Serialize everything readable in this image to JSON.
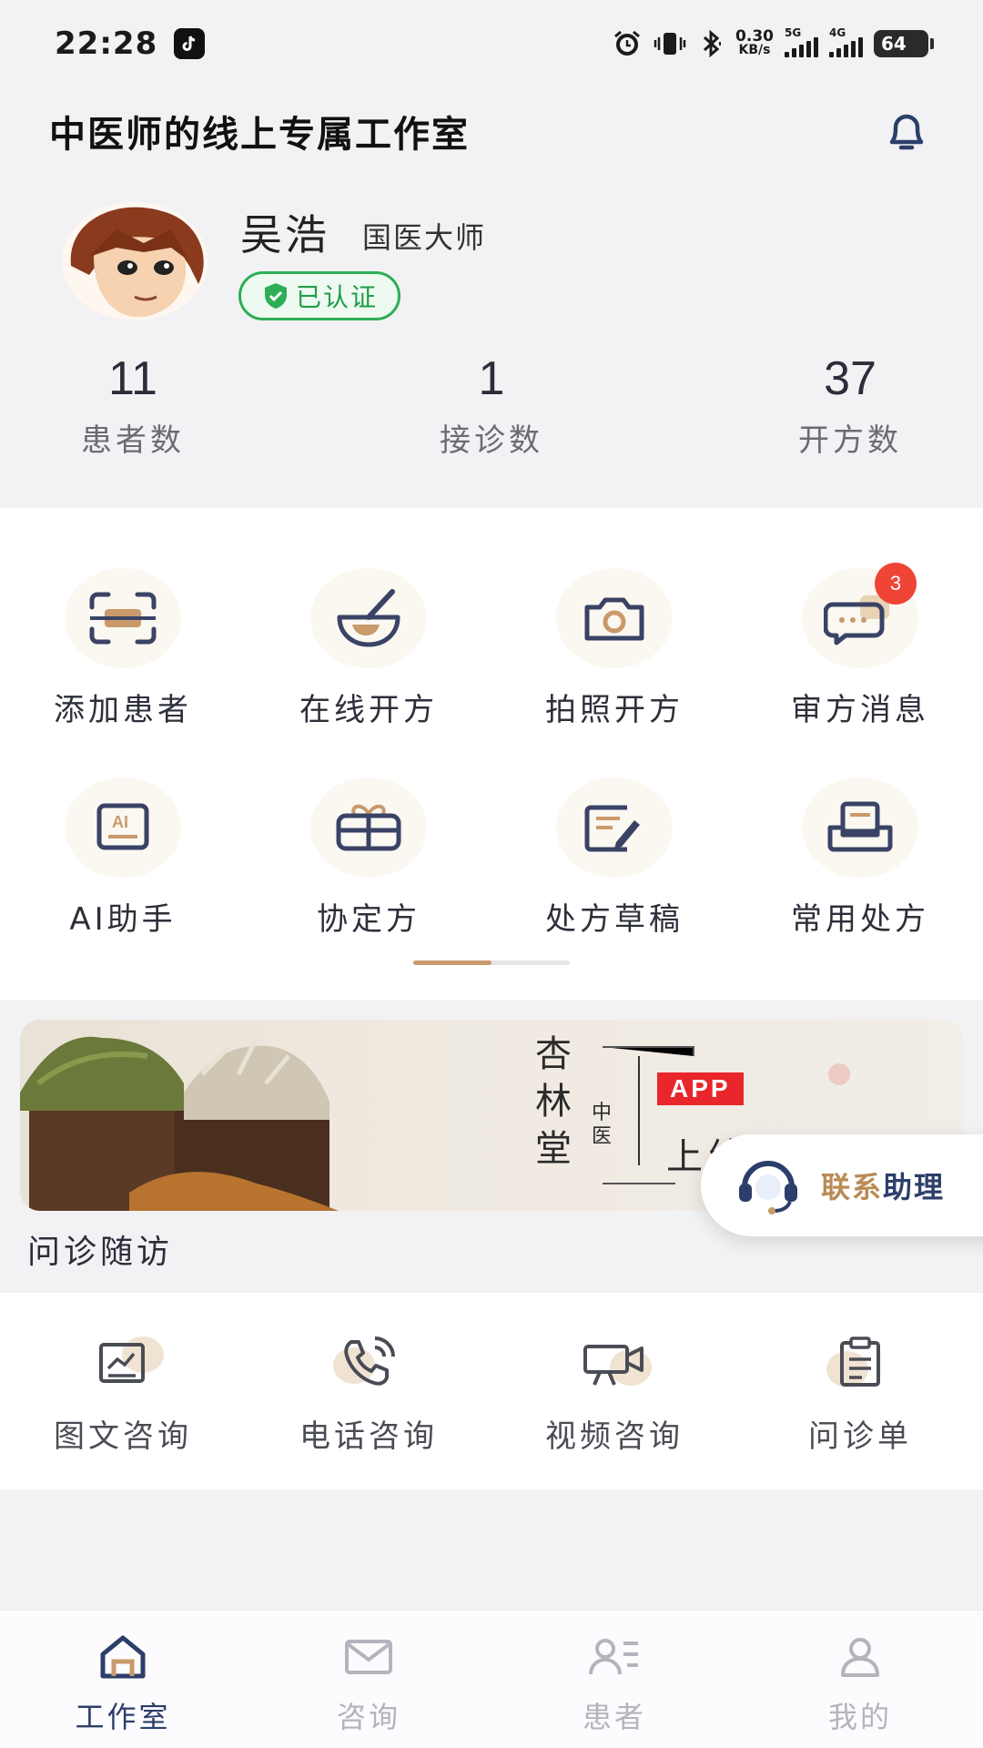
{
  "status_bar": {
    "time": "22:28",
    "net_speed_value": "0.30",
    "net_speed_unit": "KB/s",
    "signal_1": "5G",
    "signal_2": "4G",
    "battery": "64"
  },
  "header": {
    "title": "中医师的线上专属工作室",
    "bell_icon": "bell-icon"
  },
  "profile": {
    "name": "吴浩",
    "title": "国医大师",
    "verified_label": "已认证"
  },
  "stats": [
    {
      "value": "11",
      "label": "患者数"
    },
    {
      "value": "1",
      "label": "接诊数"
    },
    {
      "value": "37",
      "label": "开方数"
    }
  ],
  "features": [
    {
      "label": "添加患者",
      "icon": "scan-icon"
    },
    {
      "label": "在线开方",
      "icon": "mortar-icon"
    },
    {
      "label": "拍照开方",
      "icon": "camera-icon"
    },
    {
      "label": "审方消息",
      "icon": "message-icon",
      "badge": "3"
    },
    {
      "label": "AI助手",
      "icon": "ai-icon"
    },
    {
      "label": "协定方",
      "icon": "gift-icon"
    },
    {
      "label": "处方草稿",
      "icon": "edit-icon"
    },
    {
      "label": "常用处方",
      "icon": "tray-icon"
    }
  ],
  "banner": {
    "brand": "杏林堂",
    "tag": "中医",
    "app": "APP",
    "slogan": "上线了"
  },
  "contact": {
    "label_a": "联系",
    "label_b": "助理"
  },
  "consult_section": {
    "title": "问诊随访",
    "items": [
      {
        "label": "图文咨询",
        "icon": "image-text-icon"
      },
      {
        "label": "电话咨询",
        "icon": "phone-icon"
      },
      {
        "label": "视频咨询",
        "icon": "video-camera-icon"
      },
      {
        "label": "问诊单",
        "icon": "clipboard-icon"
      }
    ]
  },
  "bottom_nav": [
    {
      "label": "工作室",
      "icon": "home-icon",
      "active": true
    },
    {
      "label": "咨询",
      "icon": "mail-icon",
      "active": false
    },
    {
      "label": "患者",
      "icon": "patients-icon",
      "active": false
    },
    {
      "label": "我的",
      "icon": "user-icon",
      "active": false
    }
  ],
  "colors": {
    "accent_navy": "#2c3e6a",
    "accent_gold": "#c99a6b",
    "verified_green": "#2dae55",
    "badge_red": "#ef4436"
  }
}
